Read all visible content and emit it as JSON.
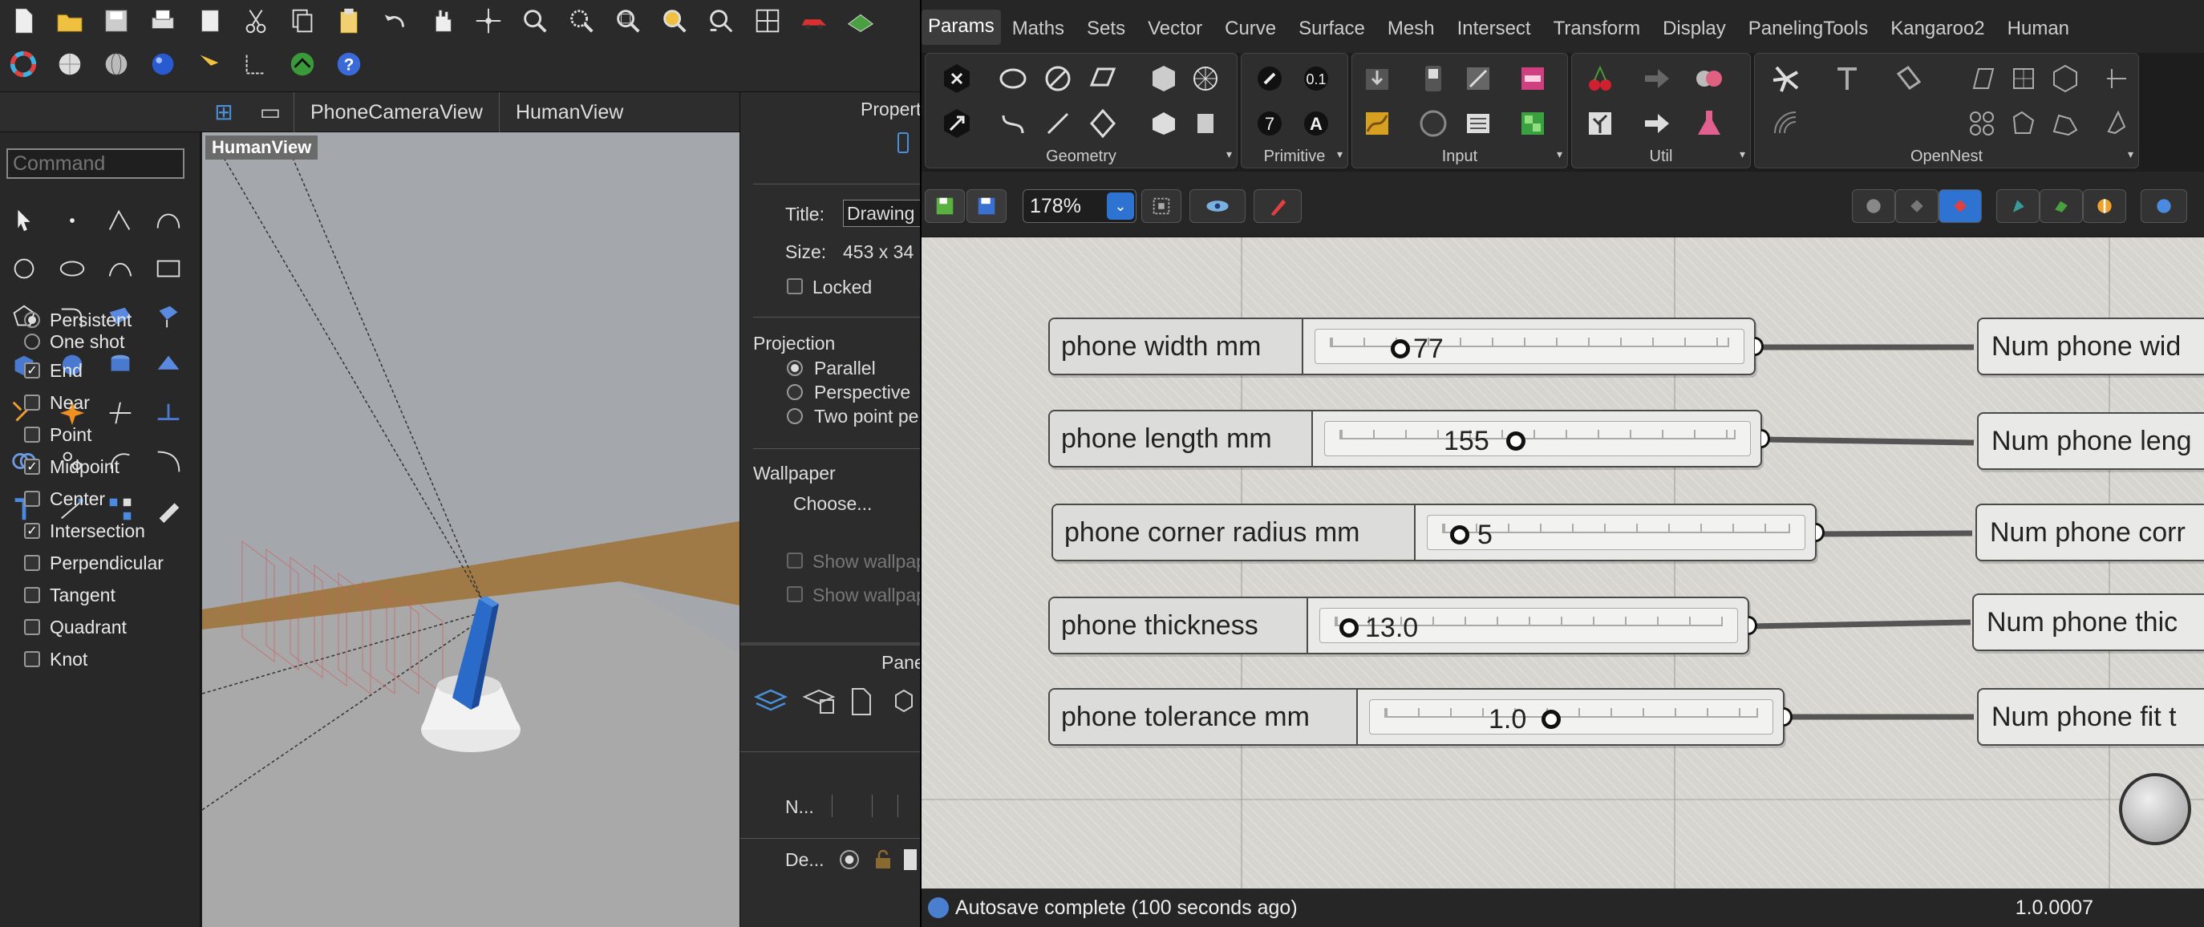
{
  "rhino": {
    "view_tabs": [
      "PhoneCameraView",
      "HumanView"
    ],
    "command_placeholder": "Command",
    "viewport_label": "HumanView",
    "osnap": {
      "mode_options": [
        {
          "label": "Persistent",
          "selected": true
        },
        {
          "label": "One shot",
          "selected": false
        }
      ],
      "snaps": [
        {
          "label": "End",
          "checked": true
        },
        {
          "label": "Near",
          "checked": false
        },
        {
          "label": "Point",
          "checked": false
        },
        {
          "label": "Midpoint",
          "checked": true
        },
        {
          "label": "Center",
          "checked": false
        },
        {
          "label": "Intersection",
          "checked": true
        },
        {
          "label": "Perpendicular",
          "checked": false
        },
        {
          "label": "Tangent",
          "checked": false
        },
        {
          "label": "Quadrant",
          "checked": false
        },
        {
          "label": "Knot",
          "checked": false
        }
      ]
    }
  },
  "properties": {
    "header": "Propert",
    "title_label": "Title:",
    "title_value": "Drawing",
    "size_label": "Size:",
    "size_value": "453 x 34",
    "locked_label": "Locked",
    "projection_label": "Projection",
    "projection_options": [
      {
        "label": "Parallel",
        "selected": true
      },
      {
        "label": "Perspective",
        "selected": false
      },
      {
        "label": "Two point pe",
        "selected": false
      }
    ],
    "wallpaper_label": "Wallpaper",
    "choose_label": "Choose...",
    "show_wallpaper_1": "Show wallpap",
    "show_wallpaper_2": "Show wallpap",
    "panels_label": "Pane",
    "layer_col_name": "N...",
    "layer_row_name": "De..."
  },
  "grasshopper": {
    "menu_tabs": [
      "Params",
      "Maths",
      "Sets",
      "Vector",
      "Curve",
      "Surface",
      "Mesh",
      "Intersect",
      "Transform",
      "Display",
      "PanelingTools",
      "Kangaroo2",
      "Human"
    ],
    "active_tab": "Params",
    "ribbon_groups": [
      "Geometry",
      "Primitive",
      "Input",
      "Util",
      "OpenNest"
    ],
    "zoom": "178%",
    "sliders": [
      {
        "name": "phone width mm",
        "value": "77",
        "fraction": 0.25
      },
      {
        "name": "phone length mm",
        "value": "155",
        "fraction": 0.5
      },
      {
        "name": "phone corner radius mm",
        "value": "5",
        "fraction": 0.0
      },
      {
        "name": "phone thickness",
        "value": "13.0",
        "fraction": 0.0
      },
      {
        "name": "phone tolerance mm",
        "value": "1.0",
        "fraction": 0.5
      }
    ],
    "num_nodes": [
      "Num phone wid",
      "Num phone leng",
      "Num phone corr",
      "Num phone thic",
      "Num phone fit t"
    ],
    "status_message": "Autosave complete (100 seconds ago)",
    "version": "1.0.0007"
  }
}
